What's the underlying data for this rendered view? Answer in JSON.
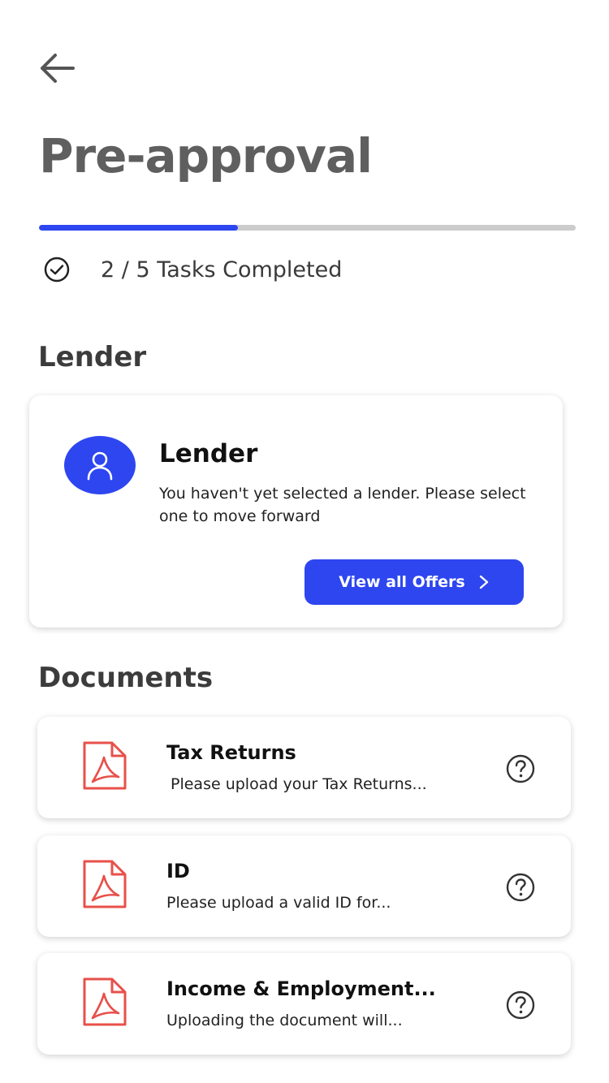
{
  "header": {
    "back_icon": "arrow-left-icon",
    "title": "Pre-approval"
  },
  "progress": {
    "completed": 2,
    "total": 5,
    "fraction": 0.37,
    "label": "2 / 5 Tasks Completed",
    "check_icon": "check-circle-icon",
    "fill_color": "#2e46f0",
    "track_color": "#cccccc"
  },
  "lender_section": {
    "heading": "Lender",
    "card": {
      "avatar_icon": "user-icon",
      "title": "Lender",
      "description": "You haven't yet selected a lender. Please select one to move forward",
      "button_label": "View all Offers",
      "button_icon": "chevron-right-icon"
    }
  },
  "documents_section": {
    "heading": "Documents",
    "items": [
      {
        "icon": "pdf-icon",
        "title": "Tax Returns",
        "description": "Please upload your Tax Returns...",
        "help_icon": "help-circle-icon"
      },
      {
        "icon": "pdf-icon",
        "title": "ID",
        "description": "Please upload a valid ID for...",
        "help_icon": "help-circle-icon"
      },
      {
        "icon": "pdf-icon",
        "title": "Income & Employment...",
        "description": "Uploading the document will...",
        "help_icon": "help-circle-icon"
      }
    ]
  },
  "colors": {
    "accent": "#2e46f0",
    "pdf_red": "#e8504a"
  }
}
